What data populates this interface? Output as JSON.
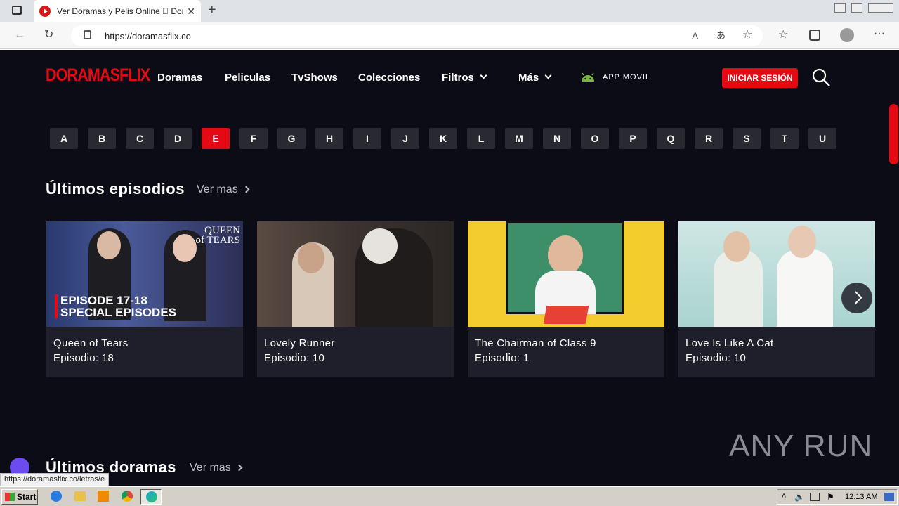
{
  "browser": {
    "tab_title": "Ver Doramas y Pelis Online ￿ Dor",
    "tab_close": "✕",
    "new_tab": "+",
    "url": "https://doramasflix.co",
    "status_url": "https://doramasflix.co/letras/e"
  },
  "site": {
    "logo": "DORAMASFLIX",
    "nav": [
      "Doramas",
      "Peliculas",
      "TvShows",
      "Colecciones",
      "Filtros",
      "Más"
    ],
    "app_label": "APP MOVIL",
    "login_label": "INICIAR SESIÓN",
    "letters": [
      "A",
      "B",
      "C",
      "D",
      "E",
      "F",
      "G",
      "H",
      "I",
      "J",
      "K",
      "L",
      "M",
      "N",
      "O",
      "P",
      "Q",
      "R",
      "S",
      "T",
      "U"
    ],
    "active_letter": "E",
    "section1": {
      "title": "Últimos episodios",
      "more": "Ver mas"
    },
    "section2": {
      "title": "Últimos doramas",
      "more": "Ver mas"
    },
    "episodes": [
      {
        "title": "Queen of Tears",
        "episode": "Episodio: 18",
        "thumb_text_1": "EPISODE 17-18",
        "thumb_text_2": "SPECIAL EPISODES",
        "thumb_logo": "QUEEN of TEARS"
      },
      {
        "title": "Lovely Runner",
        "episode": "Episodio: 10"
      },
      {
        "title": "The Chairman of Class 9",
        "episode": "Episodio: 1"
      },
      {
        "title": "Love Is Like A Cat",
        "episode": "Episodio: 10"
      }
    ],
    "colors": {
      "accent": "#e50914",
      "background": "#0c0c16",
      "card": "#1f1f2b"
    }
  },
  "watermark": "ANY RUN",
  "taskbar": {
    "start": "Start",
    "clock": "12:13 AM"
  }
}
